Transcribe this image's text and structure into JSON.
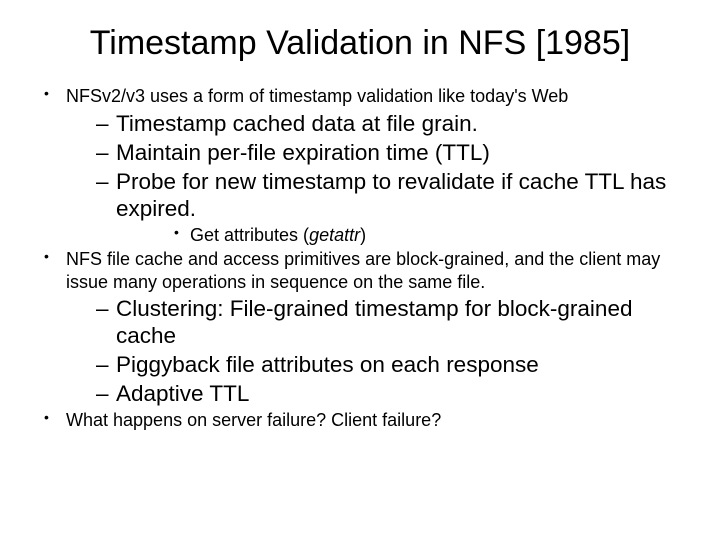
{
  "title": "Timestamp Validation in NFS [1985]",
  "bullets": {
    "b1": "NFSv2/v3 uses a form of timestamp validation like today's Web",
    "b1_sub": {
      "s1": "Timestamp cached data at file grain.",
      "s2": "Maintain per-file expiration time (TTL)",
      "s3": "Probe for new timestamp to revalidate if cache TTL has expired.",
      "s3_sub": {
        "t1_prefix": "Get attributes (",
        "t1_ital": "getattr",
        "t1_suffix": ")"
      }
    },
    "b2": "NFS file cache and access primitives are block-grained, and the client may issue many operations in sequence on the same file.",
    "b2_sub": {
      "s1": "Clustering: File-grained timestamp for block-grained cache",
      "s2": "Piggyback file attributes on each response",
      "s3": "Adaptive TTL"
    },
    "b3": "What happens on server failure?  Client failure?"
  }
}
